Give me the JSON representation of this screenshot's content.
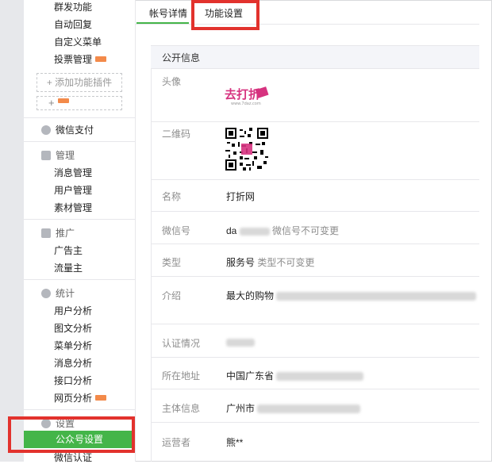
{
  "sidebar": {
    "top_items": [
      {
        "label": "群发功能",
        "new": false
      },
      {
        "label": "自动回复",
        "new": false
      },
      {
        "label": "自定义菜单",
        "new": false
      },
      {
        "label": "投票管理",
        "new": true
      }
    ],
    "add_plugin": "+ 添加功能插件",
    "add_plus": "+",
    "wechat_pay": "微信支付",
    "manage": {
      "title": "管理",
      "items": [
        "消息管理",
        "用户管理",
        "素材管理"
      ]
    },
    "promote": {
      "title": "推广",
      "items": [
        "广告主",
        "流量主"
      ]
    },
    "stats": {
      "title": "统计",
      "items": [
        "用户分析",
        "图文分析",
        "菜单分析",
        "消息分析",
        "接口分析",
        "网页分析"
      ]
    },
    "settings": {
      "title": "设置",
      "active": "公众号设置",
      "next": "微信认证"
    }
  },
  "tabs": {
    "account_details": "帐号详情",
    "function_settings": "功能设置"
  },
  "panel": {
    "title": "公开信息",
    "avatar_label": "头像",
    "logo_text": "去打折",
    "logo_sub": "www.7daz.com",
    "qr_label": "二维码",
    "name_label": "名称",
    "name_value": "打折网",
    "wechat_id_label": "微信号",
    "wechat_id_value": "da",
    "wechat_id_note": "微信号不可变更",
    "type_label": "类型",
    "type_value": "服务号",
    "type_note": "类型不可变更",
    "intro_label": "介绍",
    "intro_value": "最大的购物",
    "verify_label": "认证情况",
    "address_label": "所在地址",
    "address_value": "中国广东省",
    "entity_label": "主体信息",
    "entity_value": "广州市",
    "operator_label": "运营者",
    "operator_value": "熊**"
  },
  "colors": {
    "active_green": "#44b549",
    "highlight_red": "#e2322d",
    "new_badge": "#f38a4a",
    "logo_pink": "#d6327f"
  }
}
